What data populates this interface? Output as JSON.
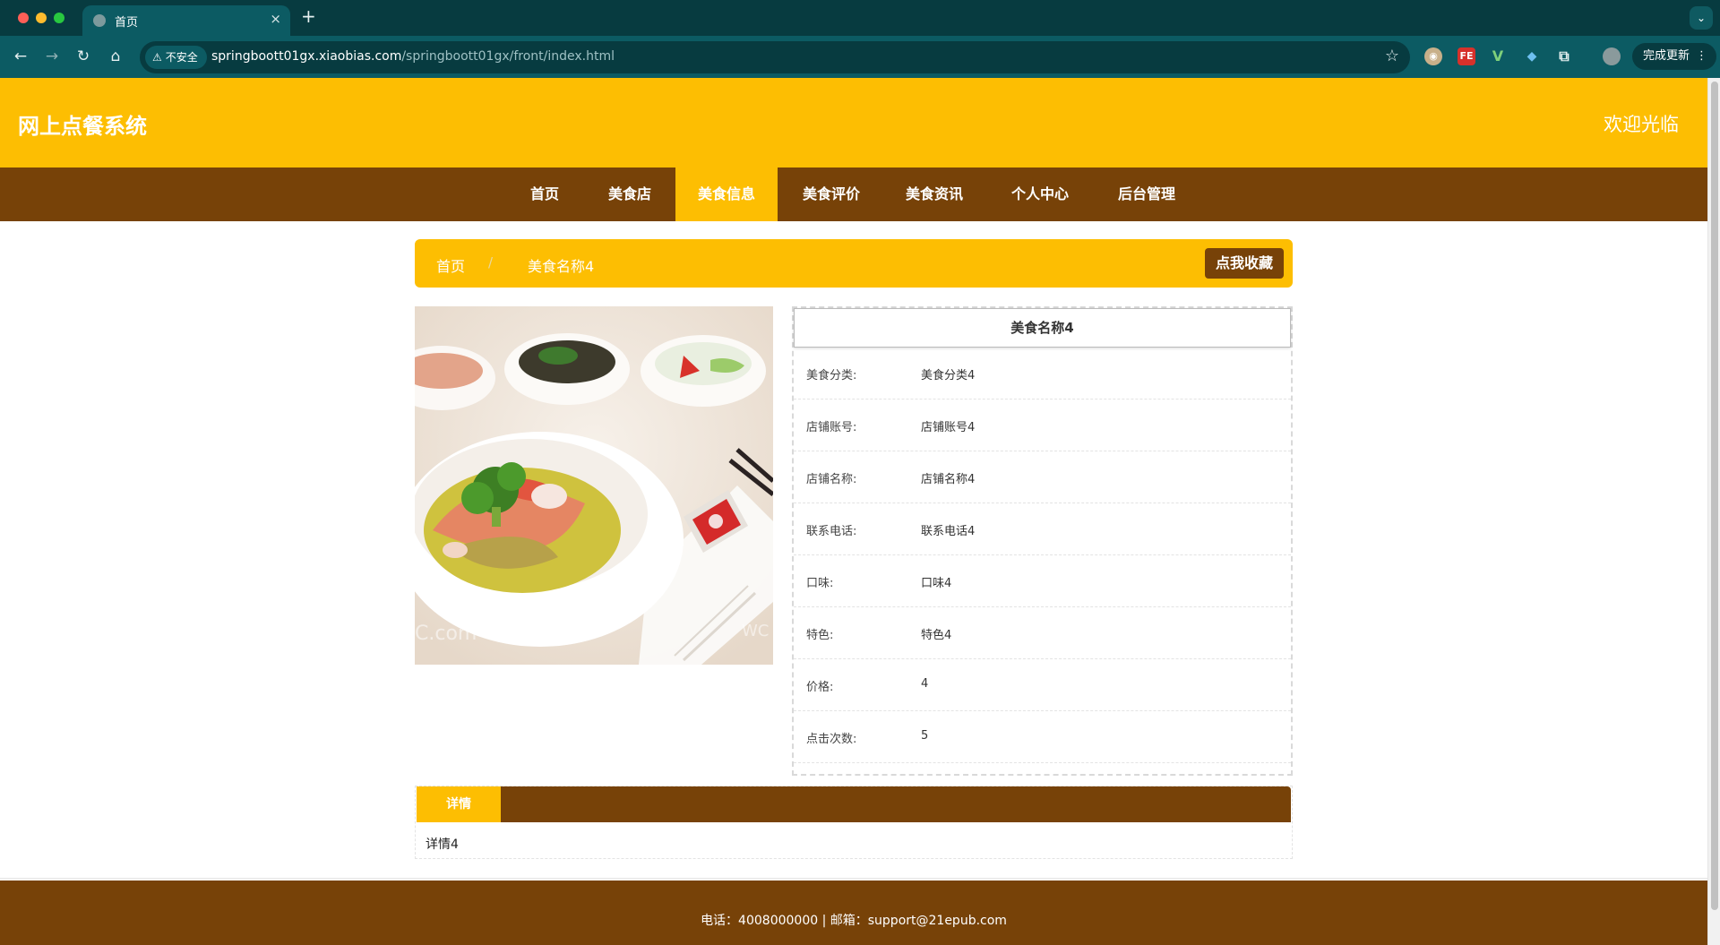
{
  "browser": {
    "tab_title": "首页",
    "tab_close": "×",
    "new_tab": "+",
    "security_label": "不安全",
    "url_host": "springboott01gx.xiaobias.com",
    "url_path": "/springboott01gx/front/index.html",
    "update_label": "完成更新",
    "update_menu": "⋮"
  },
  "site": {
    "title": "网上点餐系统",
    "welcome": "欢迎光临"
  },
  "nav": {
    "items": [
      {
        "label": "首页"
      },
      {
        "label": "美食店"
      },
      {
        "label": "美食信息"
      },
      {
        "label": "美食评价"
      },
      {
        "label": "美食资讯"
      },
      {
        "label": "个人中心"
      },
      {
        "label": "后台管理"
      }
    ],
    "active_index": 2
  },
  "breadcrumb": {
    "home": "首页",
    "separator": "/",
    "current": "美食名称4",
    "favorite_button": "点我收藏"
  },
  "detail": {
    "name": "美食名称4",
    "fields": [
      {
        "label": "美食分类:",
        "value": "美食分类4"
      },
      {
        "label": "店铺账号:",
        "value": "店铺账号4"
      },
      {
        "label": "店铺名称:",
        "value": "店铺名称4"
      },
      {
        "label": "联系电话:",
        "value": "联系电话4"
      },
      {
        "label": "口味:",
        "value": "口味4"
      },
      {
        "label": "特色:",
        "value": "特色4"
      },
      {
        "label": "价格:",
        "value": "4"
      },
      {
        "label": "点击次数:",
        "value": "5"
      }
    ]
  },
  "tabs": {
    "active_label": "详情",
    "content": "详情4"
  },
  "footer": {
    "text": "电话：4008000000 | 邮箱：support@21epub.com"
  }
}
